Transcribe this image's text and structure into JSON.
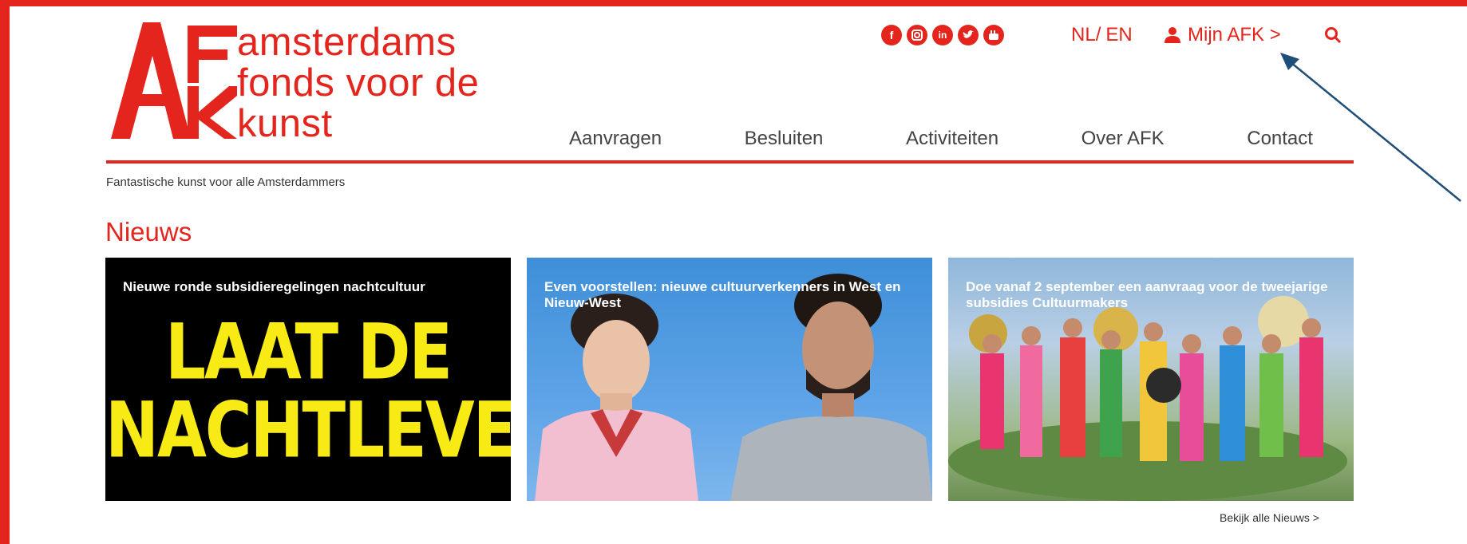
{
  "header": {
    "logo_lines": [
      "amsterdams",
      "fonds voor de",
      "kunst"
    ],
    "social_icons": [
      "facebook-icon",
      "instagram-icon",
      "linkedin-icon",
      "twitter-icon",
      "youtube-icon"
    ],
    "lang_nl": "NL",
    "lang_sep": "/",
    "lang_en": "EN",
    "mijn_label": "Mijn AFK >",
    "nav": [
      "Aanvragen",
      "Besluiten",
      "Activiteiten",
      "Over AFK",
      "Contact"
    ]
  },
  "tagline": "Fantastische kunst voor alle Amsterdammers",
  "news": {
    "title": "Nieuws",
    "cards": [
      {
        "title": "Nieuwe ronde subsidieregelingen nachtcultuur",
        "big_text": [
          "LAAT DE",
          "NACHTLEVEN"
        ]
      },
      {
        "title": "Even voorstellen: nieuwe cultuurverkenners in West en Nieuw-West"
      },
      {
        "title": "Doe vanaf 2 september een aanvraag voor de tweejarige subsidies Cultuurmakers"
      }
    ],
    "more": "Bekijk alle Nieuws >"
  },
  "colors": {
    "brand": "#e3251d",
    "accent_yellow": "#f8ea14"
  }
}
